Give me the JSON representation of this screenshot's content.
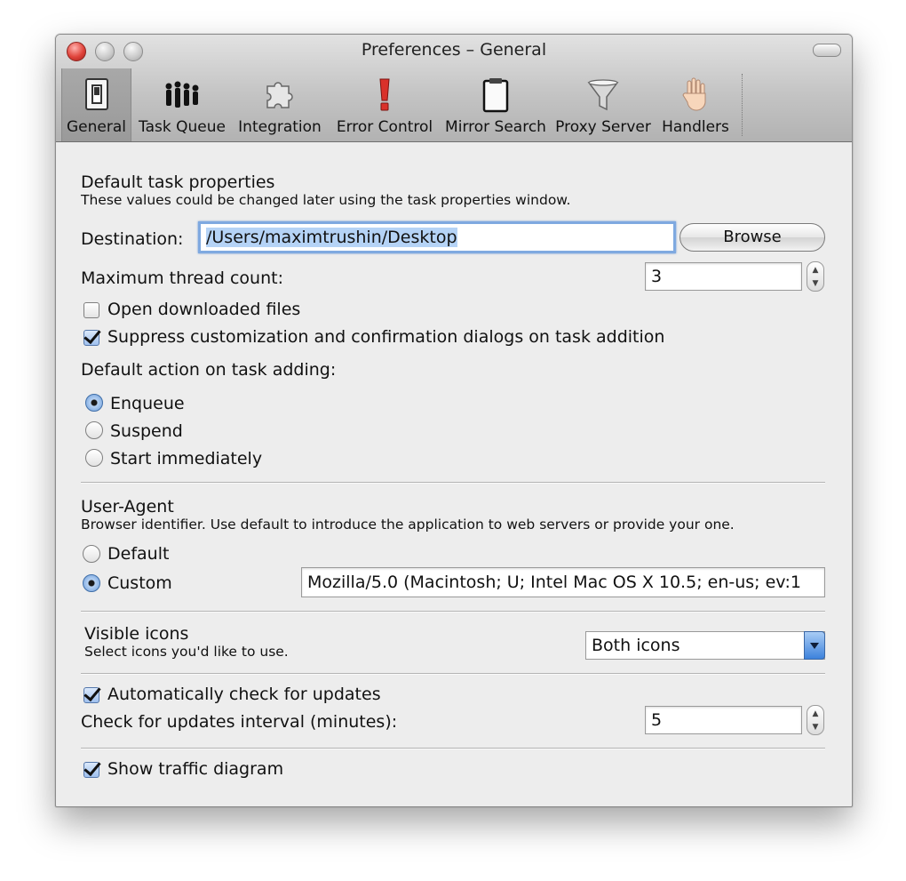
{
  "window": {
    "title": "Preferences – General"
  },
  "toolbar": {
    "items": [
      {
        "label": "General",
        "icon": "switch-icon",
        "selected": true
      },
      {
        "label": "Task Queue",
        "icon": "people-icon"
      },
      {
        "label": "Integration",
        "icon": "puzzle-icon"
      },
      {
        "label": "Error Control",
        "icon": "exclamation-icon"
      },
      {
        "label": "Mirror Search",
        "icon": "clipboard-icon"
      },
      {
        "label": "Proxy Server",
        "icon": "funnel-icon"
      },
      {
        "label": "Handlers",
        "icon": "hand-icon"
      }
    ]
  },
  "task_properties": {
    "heading": "Default task properties",
    "description": "These values could be changed later using the task properties window.",
    "destination_label": "Destination:",
    "destination_value": "/Users/maximtrushin/Desktop",
    "browse_label": "Browse",
    "thread_label": "Maximum thread count:",
    "thread_value": "3",
    "open_downloaded_label": "Open downloaded files",
    "open_downloaded_checked": false,
    "suppress_label": "Suppress customization and confirmation dialogs on task addition",
    "suppress_checked": true,
    "default_action_label": "Default action on task adding:",
    "actions": [
      {
        "label": "Enqueue",
        "selected": true
      },
      {
        "label": "Suspend",
        "selected": false
      },
      {
        "label": "Start immediately",
        "selected": false
      }
    ]
  },
  "user_agent": {
    "heading": "User-Agent",
    "description": "Browser identifier. Use default to introduce the application to web servers or provide your one.",
    "options": [
      {
        "label": "Default",
        "selected": false
      },
      {
        "label": "Custom",
        "selected": true
      }
    ],
    "custom_value": "Mozilla/5.0 (Macintosh; U; Intel Mac OS X 10.5; en-us; ev:1"
  },
  "visible_icons": {
    "heading": "Visible icons",
    "description": "Select icons you'd like to use.",
    "selected": "Both icons"
  },
  "updates": {
    "auto_check_label": "Automatically check for updates",
    "auto_check_checked": true,
    "interval_label": "Check for updates interval (minutes):",
    "interval_value": "5"
  },
  "traffic": {
    "label": "Show traffic diagram",
    "checked": true
  },
  "colors": {
    "close_button": "#e0443b",
    "selection_highlight": "#b5d3f6",
    "focus_ring": "#7fa9e0",
    "popup_arrow": "#3d82dc"
  }
}
